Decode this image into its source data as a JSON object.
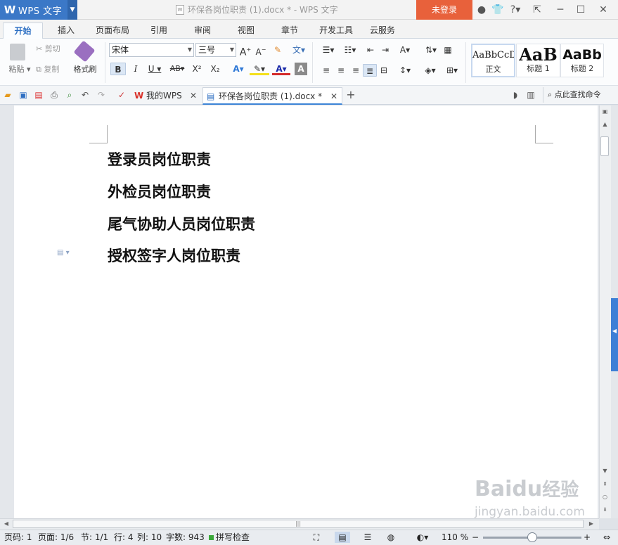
{
  "app": {
    "name": "WPS 文字",
    "logo": "W",
    "title": "环保各岗位职责 (1).docx * - WPS 文字",
    "login": "未登录"
  },
  "menu_tabs": [
    "开始",
    "插入",
    "页面布局",
    "引用",
    "审阅",
    "视图",
    "章节",
    "开发工具",
    "云服务"
  ],
  "clipboard": {
    "paste": "粘贴",
    "cut": "剪切",
    "copy": "复制",
    "format_painter": "格式刷"
  },
  "font": {
    "name": "宋体",
    "size": "三号"
  },
  "styles": [
    {
      "preview": "AaBbCcD",
      "label": "正文"
    },
    {
      "preview": "AaB",
      "label": "标题 1"
    },
    {
      "preview": "AaBb",
      "label": "标题 2"
    }
  ],
  "doc_tabs": {
    "mywps": "我的WPS",
    "doc": "环保各岗位职责 (1).docx *",
    "search": "点此查找命令"
  },
  "document": {
    "headings": [
      "登录员岗位职责",
      "外检员岗位职责",
      "尾气协助人员岗位职责",
      "授权签字人岗位职责"
    ]
  },
  "status": {
    "page_code": "页码: 1",
    "page": "页面: 1/6",
    "section": "节: 1/1",
    "row": "行: 4",
    "col": "列: 10",
    "words": "字数: 943",
    "spell": "拼写检查",
    "zoom": "110 %"
  },
  "watermark": {
    "brand": "Baidu",
    "sub": "经验",
    "url": "jingyan.baidu.com"
  },
  "colors": {
    "accent": "#3b78c7",
    "login": "#e8613b",
    "tab_active": "#2c6fc3"
  }
}
